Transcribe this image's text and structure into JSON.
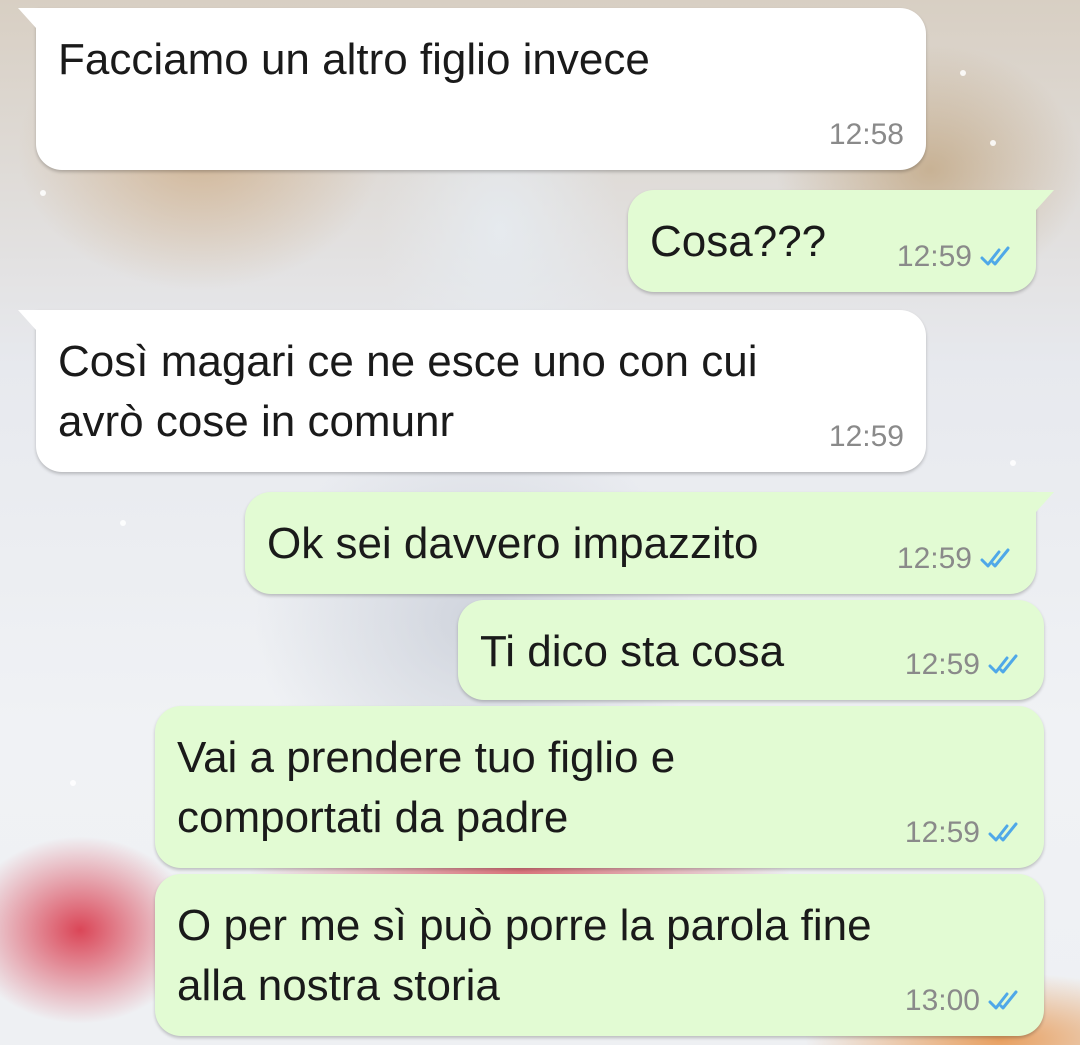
{
  "colors": {
    "incoming_bubble": "#ffffff",
    "outgoing_bubble": "#e2fbd3",
    "read_ticks": "#4fa8e8",
    "timestamp": "#8a8a8a"
  },
  "messages": [
    {
      "direction": "incoming",
      "text": "Facciamo un altro figlio invece",
      "time": "12:58"
    },
    {
      "direction": "outgoing",
      "text": "Cosa???",
      "time": "12:59",
      "status_icon": "read-double-check-icon"
    },
    {
      "direction": "incoming",
      "text": "Così magari ce ne esce uno con cui\navrò cose in comunr",
      "time": "12:59"
    },
    {
      "direction": "outgoing",
      "text": "Ok sei davvero impazzito",
      "time": "12:59",
      "status_icon": "read-double-check-icon"
    },
    {
      "direction": "outgoing",
      "text": "Ti dico sta cosa",
      "time": "12:59",
      "status_icon": "read-double-check-icon"
    },
    {
      "direction": "outgoing",
      "text": "Vai a prendere tuo figlio e\ncomportati da padre",
      "time": "12:59",
      "status_icon": "read-double-check-icon"
    },
    {
      "direction": "outgoing",
      "text": "O per me sì può porre la parola fine\nalla nostra storia",
      "time": "13:00",
      "status_icon": "read-double-check-icon"
    }
  ]
}
